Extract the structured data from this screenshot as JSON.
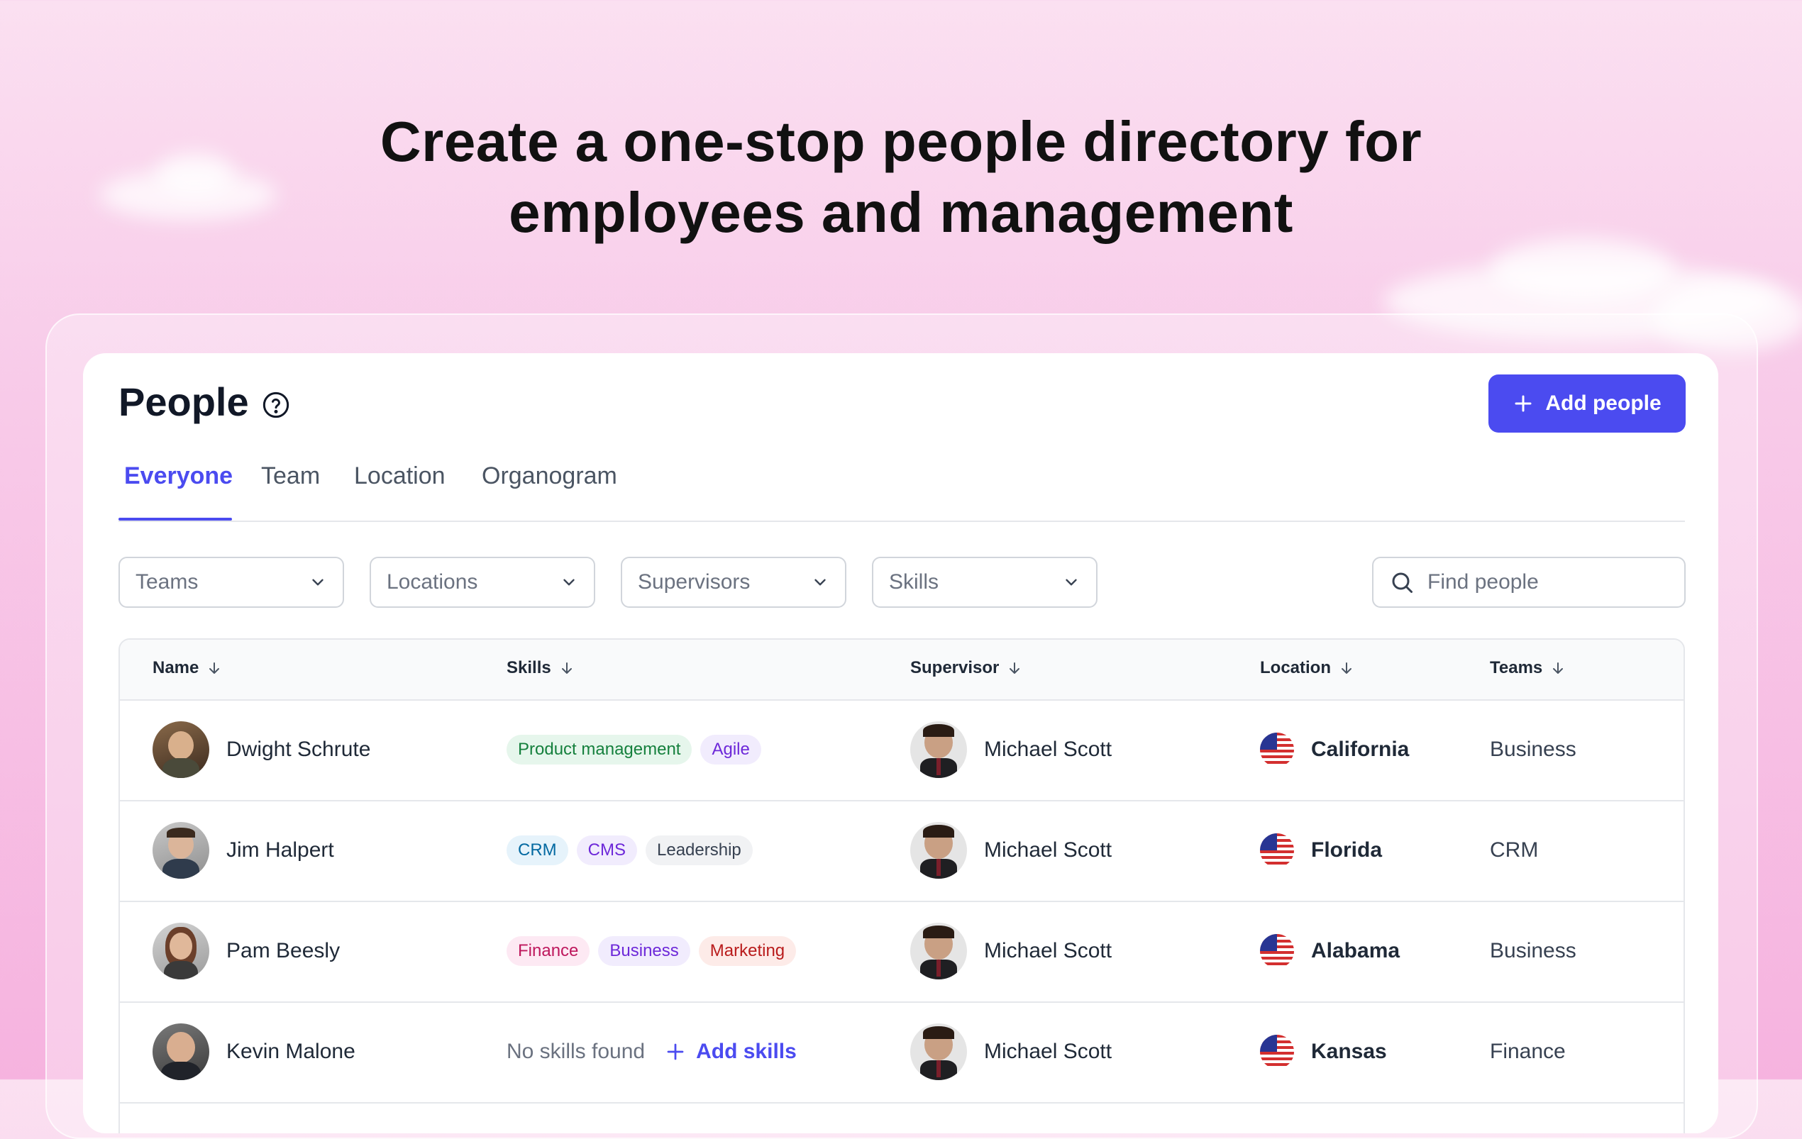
{
  "hero": {
    "line1": "Create a one-stop people directory for",
    "line2": "employees and management"
  },
  "header": {
    "title": "People",
    "help_icon": "question-circle-icon",
    "add_button_label": "Add people",
    "add_button_icon": "plus-icon"
  },
  "tabs": [
    {
      "label": "Everyone",
      "active": true
    },
    {
      "label": "Team",
      "active": false
    },
    {
      "label": "Location",
      "active": false
    },
    {
      "label": "Organogram",
      "active": false
    }
  ],
  "filters": [
    {
      "label": "Teams"
    },
    {
      "label": "Locations"
    },
    {
      "label": "Supervisors"
    },
    {
      "label": "Skills"
    }
  ],
  "search": {
    "placeholder": "Find people",
    "icon": "search-icon"
  },
  "table": {
    "columns": [
      "Name",
      "Skills",
      "Supervisor",
      "Location",
      "Teams"
    ],
    "rows": [
      {
        "name": "Dwight Schrute",
        "skills": [
          {
            "label": "Product management",
            "bg": "#e6f6ec",
            "fg": "#15803d"
          },
          {
            "label": "Agile",
            "bg": "#f1ecfd",
            "fg": "#6d28d9"
          }
        ],
        "supervisor": "Michael Scott",
        "location": "California",
        "team": "Business"
      },
      {
        "name": "Jim Halpert",
        "skills": [
          {
            "label": "CRM",
            "bg": "#e6f3fb",
            "fg": "#0369a1"
          },
          {
            "label": "CMS",
            "bg": "#f1ecfd",
            "fg": "#6d28d9"
          },
          {
            "label": "Leadership",
            "bg": "#f1f2f4",
            "fg": "#374151"
          }
        ],
        "supervisor": "Michael Scott",
        "location": "Florida",
        "team": "CRM"
      },
      {
        "name": "Pam Beesly",
        "skills": [
          {
            "label": "Finance",
            "bg": "#fde9f3",
            "fg": "#be185d"
          },
          {
            "label": "Business",
            "bg": "#f1ecfd",
            "fg": "#6d28d9"
          },
          {
            "label": "Marketing",
            "bg": "#fdebe8",
            "fg": "#b91c1c"
          }
        ],
        "supervisor": "Michael Scott",
        "location": "Alabama",
        "team": "Business"
      },
      {
        "name": "Kevin Malone",
        "skills": [],
        "no_skills_text": "No skills found",
        "add_skills_label": "Add skills",
        "supervisor": "Michael Scott",
        "location": "Kansas",
        "team": "Finance"
      }
    ]
  },
  "colors": {
    "accent": "#4b4bf0",
    "background_top": "#fbe0f1",
    "background_bottom": "#f6b3df"
  }
}
